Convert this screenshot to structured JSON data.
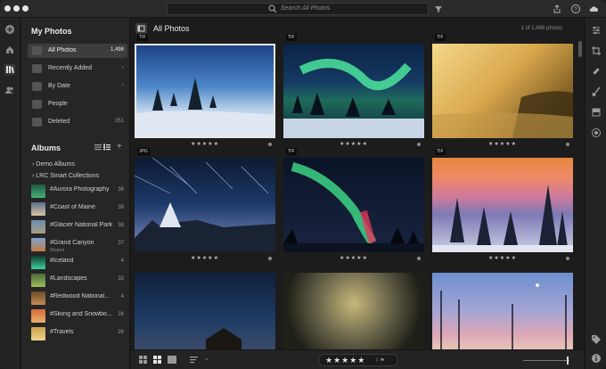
{
  "search": {
    "placeholder": "Search All Photos"
  },
  "sidebar": {
    "my_photos_heading": "My Photos",
    "items": [
      {
        "label": "All Photos",
        "count": "1,498",
        "active": true
      },
      {
        "label": "Recently Added",
        "count": "‹"
      },
      {
        "label": "By Date",
        "count": "‹"
      },
      {
        "label": "People",
        "count": ""
      },
      {
        "label": "Deleted",
        "count": "351"
      }
    ],
    "albums_heading": "Albums",
    "add_label": "+",
    "collections": [
      {
        "label": "Demo Albums"
      },
      {
        "label": "LRC Smart Collections"
      }
    ],
    "albums": [
      {
        "label": "#Aurora Photography",
        "count": "36",
        "sub": ""
      },
      {
        "label": "#Coast of Maine",
        "count": "38",
        "sub": ""
      },
      {
        "label": "#Glacier National Park",
        "count": "38",
        "sub": ""
      },
      {
        "label": "#Grand Canyon",
        "count": "37",
        "sub": "Shared"
      },
      {
        "label": "#Iceland",
        "count": "4",
        "sub": ""
      },
      {
        "label": "#Landscapes",
        "count": "33",
        "sub": ""
      },
      {
        "label": "#Redwood National...",
        "count": "4",
        "sub": ""
      },
      {
        "label": "#Skiing and Snowbo...",
        "count": "26",
        "sub": ""
      },
      {
        "label": "#Travels",
        "count": "26",
        "sub": ""
      }
    ]
  },
  "main": {
    "title": "All Photos",
    "count_text": "1 of 1,498 photos",
    "photos": [
      {
        "badge": "TIF",
        "stars": "★★★★★",
        "selected": true
      },
      {
        "badge": "TIF",
        "stars": "★★★★★"
      },
      {
        "badge": "TIF",
        "stars": "★★★★★"
      },
      {
        "badge": "JPG",
        "stars": "★★★★★"
      },
      {
        "badge": "TIF",
        "stars": "★★★★★"
      },
      {
        "badge": "TIF",
        "stars": "★★★★★"
      },
      {
        "badge": "",
        "stars": ""
      },
      {
        "badge": "",
        "stars": ""
      },
      {
        "badge": "",
        "stars": ""
      }
    ]
  },
  "bottombar": {
    "rating_stars": "★★★★★",
    "flags": "⚐⚑"
  },
  "colors": {
    "accent": "#e9e9e9",
    "background": "#1c1c1c",
    "sidebar": "#262626"
  }
}
